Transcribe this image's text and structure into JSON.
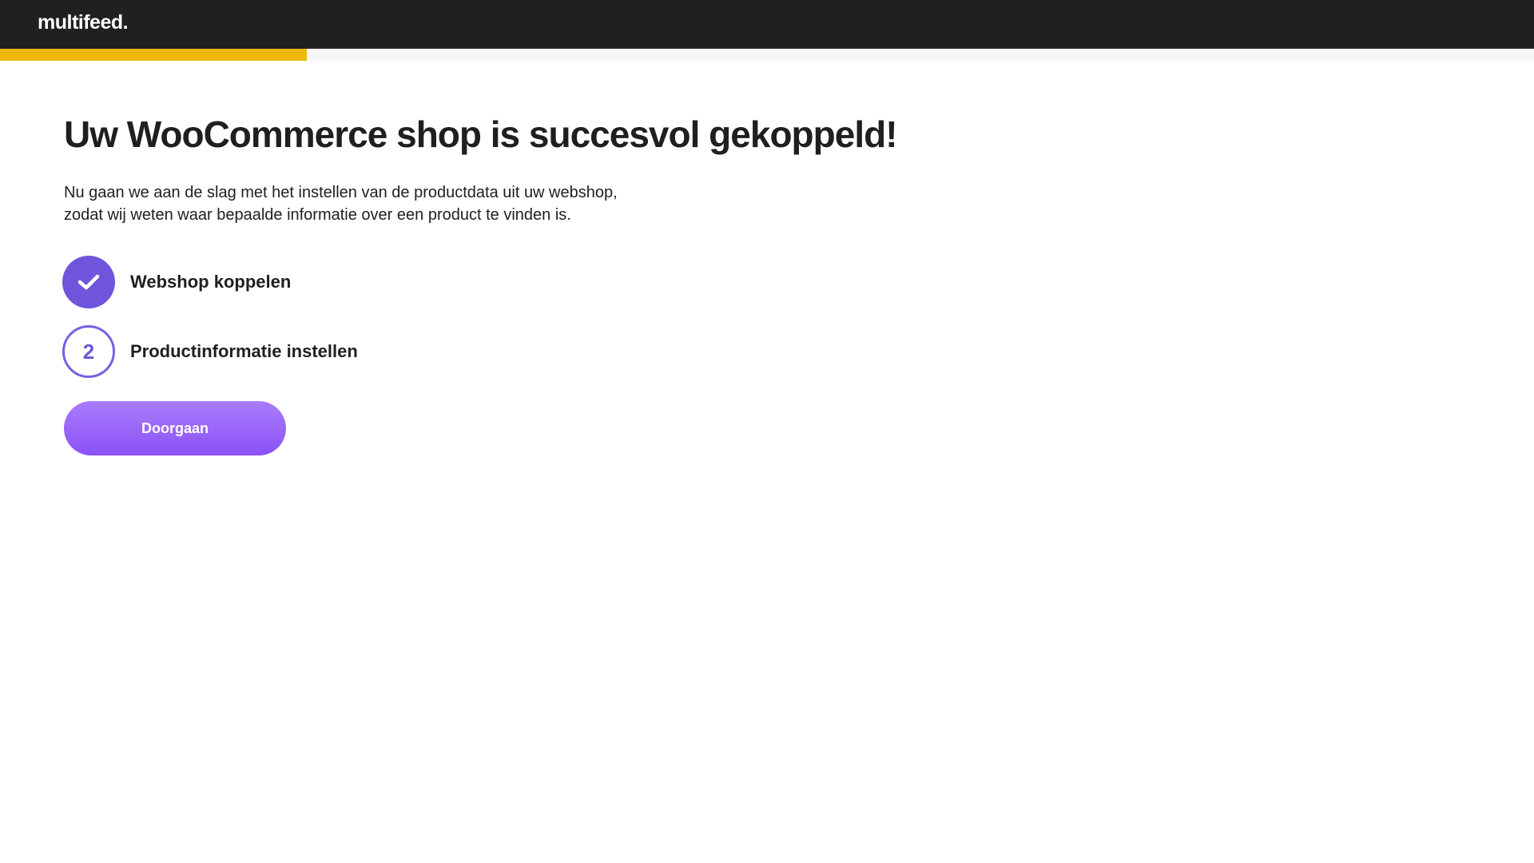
{
  "header": {
    "logo_text": "multifeed.",
    "background": "#202020"
  },
  "progress": {
    "fraction": 0.2,
    "color": "#efb70e"
  },
  "main": {
    "title": "Uw WooCommerce shop is succesvol gekoppeld!",
    "intro_line1": "Nu gaan we aan de slag met het instellen van de productdata uit uw webshop,",
    "intro_line2": "zodat wij weten waar bepaalde informatie over een product te vinden is.",
    "steps": [
      {
        "icon": "check-icon",
        "status": "completed",
        "label": "Webshop koppelen"
      },
      {
        "number": "2",
        "status": "current",
        "label": "Productinformatie instellen"
      }
    ],
    "continue_label": "Doorgaan"
  },
  "colors": {
    "accent": "#6f55dc",
    "button_top": "#a97dfb",
    "button_bottom": "#8b51f6"
  }
}
